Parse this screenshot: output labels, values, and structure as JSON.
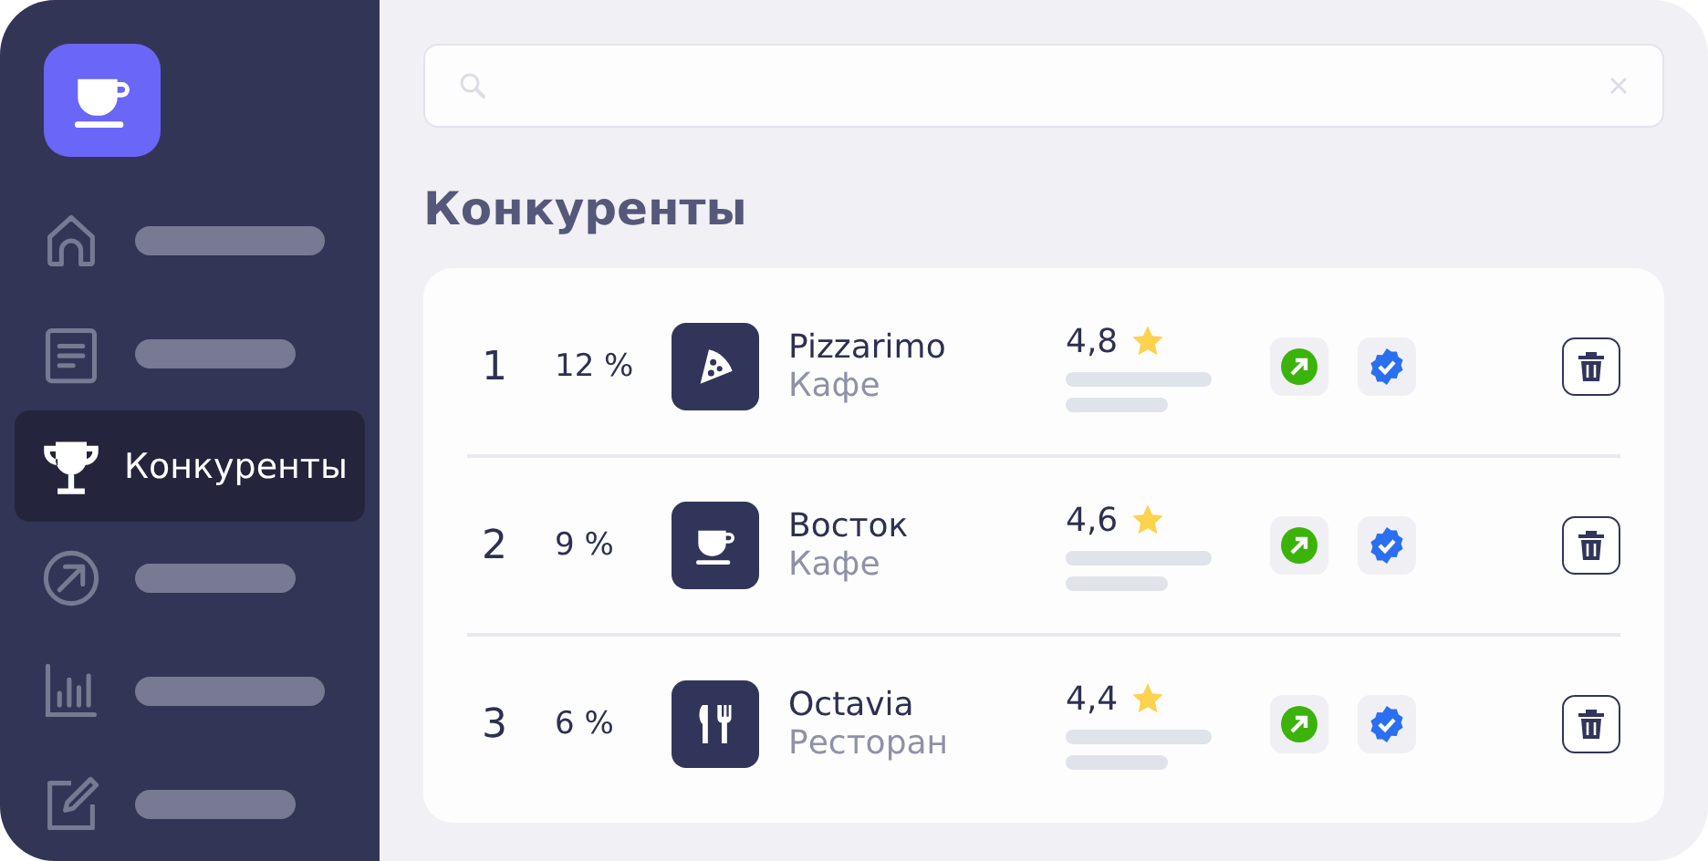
{
  "sidebar": {
    "items": [
      {
        "selected": false
      },
      {
        "selected": false
      },
      {
        "label": "Конкуренты",
        "selected": true
      },
      {
        "selected": false
      },
      {
        "selected": false
      },
      {
        "selected": false
      }
    ]
  },
  "heading": "Конкуренты",
  "competitors": [
    {
      "rank": "1",
      "share": "12 %",
      "kind": "pizza",
      "name": "Pizzarimo",
      "category": "Кафе",
      "rating": "4,8"
    },
    {
      "rank": "2",
      "share": "9 %",
      "kind": "cafe",
      "name": "Восток",
      "category": "Кафе",
      "rating": "4,6"
    },
    {
      "rank": "3",
      "share": "6 %",
      "kind": "restaurant",
      "name": "Octavia",
      "category": "Ресторан",
      "rating": "4,4"
    }
  ]
}
